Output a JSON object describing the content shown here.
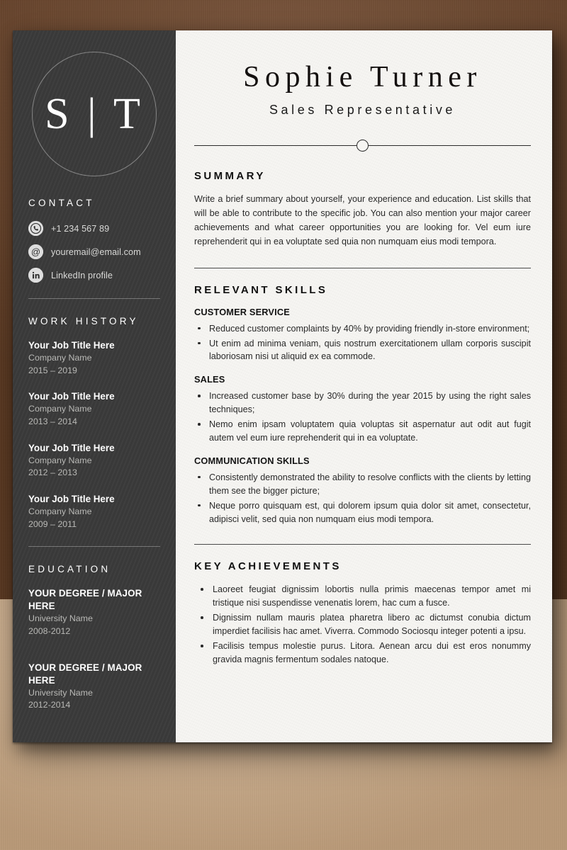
{
  "document": {
    "type": "resume-template"
  },
  "sidebar": {
    "monogram": "S | T",
    "contact": {
      "heading": "CONTACT",
      "items": [
        {
          "icon": "phone-icon",
          "text": "+1 234 567 89"
        },
        {
          "icon": "email-icon",
          "text": "youremail@email.com"
        },
        {
          "icon": "linkedin-icon",
          "text": "LinkedIn profile"
        }
      ]
    },
    "work_history": {
      "heading": "WORK HISTORY",
      "entries": [
        {
          "title": "Your Job Title Here",
          "company": "Company Name",
          "dates": "2015 – 2019"
        },
        {
          "title": "Your Job Title Here",
          "company": "Company Name",
          "dates": "2013 – 2014"
        },
        {
          "title": "Your Job Title Here",
          "company": "Company Name",
          "dates": "2012 – 2013"
        },
        {
          "title": "Your Job Title Here",
          "company": "Company Name",
          "dates": "2009 – 2011"
        }
      ]
    },
    "education": {
      "heading": "EDUCATION",
      "entries": [
        {
          "degree": "YOUR DEGREE / MAJOR HERE",
          "school": "University Name",
          "dates": "2008-2012"
        },
        {
          "degree": "YOUR DEGREE / MAJOR HERE",
          "school": "University Name",
          "dates": "2012-2014"
        }
      ]
    }
  },
  "header": {
    "name": "Sophie Turner",
    "role": "Sales Representative"
  },
  "summary": {
    "heading": "SUMMARY",
    "text": "Write a brief summary about yourself, your experience and education. List skills that will be able to contribute to the specific job. You can also mention your major career achievements and what career opportunities you are looking for. Vel eum iure reprehenderit qui in ea voluptate sed quia non numquam eius modi tempora."
  },
  "relevant_skills": {
    "heading": "RELEVANT SKILLS",
    "groups": [
      {
        "title": "CUSTOMER SERVICE",
        "bullets": [
          "Reduced customer complaints by 40% by providing friendly in-store environment;",
          "Ut enim ad minima veniam, quis nostrum exercitationem ullam corporis suscipit laboriosam nisi ut aliquid ex ea commode."
        ]
      },
      {
        "title": "SALES",
        "bullets": [
          "Increased customer base by 30% during the year 2015 by using the right sales techniques;",
          "Nemo enim ipsam voluptatem quia voluptas sit aspernatur aut odit aut fugit autem vel eum iure reprehenderit qui in ea voluptate."
        ]
      },
      {
        "title": "COMMUNICATION SKILLS",
        "bullets": [
          "Consistently demonstrated the ability to resolve conflicts with the clients by letting them see the bigger picture;",
          "Neque porro quisquam est, qui dolorem ipsum quia dolor sit amet, consectetur, adipisci velit, sed quia non numquam eius modi tempora."
        ]
      }
    ]
  },
  "key_achievements": {
    "heading": "KEY ACHIEVEMENTS",
    "bullets": [
      "Laoreet feugiat dignissim lobortis nulla primis maecenas tempor amet mi tristique nisi suspendisse venenatis lorem, hac cum a fusce.",
      "Dignissim nullam mauris platea pharetra libero ac dictumst conubia dictum imperdiet facilisis hac amet. Viverra. Commodo Sociosqu integer potenti a ipsu.",
      "Facilisis tempus molestie purus. Litora. Aenean arcu dui est eros nonummy gravida magnis fermentum sodales natoque."
    ]
  },
  "colors": {
    "sidebar_bg": "#3a3a3a",
    "paper_bg": "#f6f5f2",
    "text_dark": "#111111",
    "text_muted": "#b9b9b6",
    "backdrop_top": "#6b4226",
    "backdrop_bottom": "#cdad89"
  }
}
